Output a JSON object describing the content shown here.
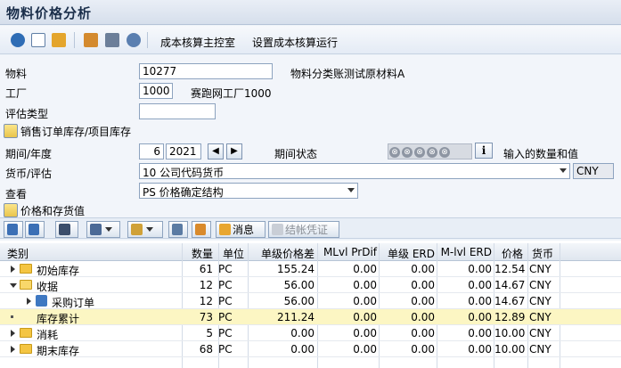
{
  "window": {
    "title": "物料价格分析"
  },
  "toolbar": {
    "icons": [
      "refresh-icon",
      "display-icon",
      "hierarchy-icon",
      "settings-icon",
      "table-icon",
      "audio-icon"
    ],
    "menu_control": "成本核算主控室",
    "menu_settings": "设置成本核算运行"
  },
  "form": {
    "material_label": "物料",
    "material_value": "10277",
    "material_desc": "物料分类账测试原材料A",
    "plant_label": "工厂",
    "plant_value": "1000",
    "plant_desc": "赛跑网工厂1000",
    "valuation_label": "评估类型",
    "valuation_value": "",
    "sales_section": "销售订单库存/项目库存",
    "period_label": "期间/年度",
    "period_value": "6",
    "year_value": "2021",
    "period_status_label": "期间状态",
    "period_status_icons": [
      "⊗",
      "⊗",
      "⊗",
      "⊗",
      "⊗"
    ],
    "info_label": "i",
    "input_label": "输入的数量和值",
    "currency_label": "货币/评估",
    "currency_value": "10 公司代码货币",
    "currency_code": "CNY",
    "view_label": "查看",
    "view_value": "PS 价格确定结构",
    "price_section": "价格和存货值"
  },
  "grid_toolbar": {
    "message_label": "消息",
    "posting_label": "结帐凭证"
  },
  "table": {
    "headers": [
      "类别",
      "数量",
      "单位",
      "单级价格差",
      "MLvl PrDif",
      "单级 ERD",
      "M-lvl ERD",
      "价格",
      "货币"
    ],
    "rows": [
      {
        "category": "初始库存",
        "qty": "61",
        "unit": "PC",
        "diff": "155.24",
        "mlvl": "0.00",
        "erd": "0.00",
        "mlvlerd": "0.00",
        "price": "12.54",
        "currency": "CNY"
      },
      {
        "category": "收据",
        "qty": "12",
        "unit": "PC",
        "diff": "56.00",
        "mlvl": "0.00",
        "erd": "0.00",
        "mlvlerd": "0.00",
        "price": "14.67",
        "currency": "CNY"
      },
      {
        "category": "采购订单",
        "qty": "12",
        "unit": "PC",
        "diff": "56.00",
        "mlvl": "0.00",
        "erd": "0.00",
        "mlvlerd": "0.00",
        "price": "14.67",
        "currency": "CNY"
      },
      {
        "category": "库存累计",
        "qty": "73",
        "unit": "PC",
        "diff": "211.24",
        "mlvl": "0.00",
        "erd": "0.00",
        "mlvlerd": "0.00",
        "price": "12.89",
        "currency": "CNY"
      },
      {
        "category": "消耗",
        "qty": "5",
        "unit": "PC",
        "diff": "0.00",
        "mlvl": "0.00",
        "erd": "0.00",
        "mlvlerd": "0.00",
        "price": "10.00",
        "currency": "CNY"
      },
      {
        "category": "期末库存",
        "qty": "68",
        "unit": "PC",
        "diff": "0.00",
        "mlvl": "0.00",
        "erd": "0.00",
        "mlvlerd": "0.00",
        "price": "10.00",
        "currency": "CNY"
      }
    ]
  },
  "colors": {
    "highlight_row": "#fcf6c3",
    "folder": "#f4c542",
    "title": "#1a2e4a"
  }
}
